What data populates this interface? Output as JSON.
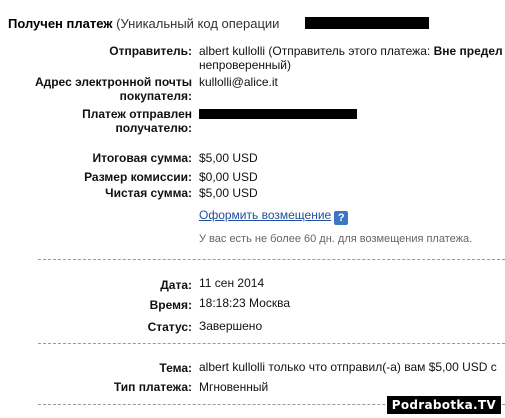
{
  "header": {
    "title": "Получен платеж",
    "code_prefix": "(Уникальный код операции"
  },
  "sender": {
    "label": "Отправитель:",
    "name": "albert kullolli",
    "note_prefix": "(Отправитель этого платежа:",
    "status_bold": "Вне предел",
    "status_line2": "непроверенный)"
  },
  "email": {
    "label_line1": "Адрес электронной почты",
    "label_line2": "покупателя:",
    "value": "kullolli@alice.it"
  },
  "recipient": {
    "label_line1": "Платеж отправлен",
    "label_line2": "получателю:"
  },
  "amounts": {
    "total_label": "Итоговая сумма:",
    "total_value": "$5,00 USD",
    "fee_label": "Размер комиссии:",
    "fee_value": "$0,00 USD",
    "net_label": "Чистая сумма:",
    "net_value": "$5,00 USD"
  },
  "refund": {
    "link": "Оформить возмещение",
    "help_icon": "?",
    "note": "У вас есть не более 60 дн. для возмещения платежа."
  },
  "details": {
    "date_label": "Дата:",
    "date_value": "11 сен 2014",
    "time_label": "Время:",
    "time_value": "18:18:23 Москва",
    "status_label": "Статус:",
    "status_value": "Завершено"
  },
  "subject": {
    "label": "Тема:",
    "value": "albert kullolli только что отправил(-а) вам $5,00 USD с",
    "type_label": "Тип платежа:",
    "type_value": "Мгновенный"
  },
  "watermark": "Podrabotka.TV"
}
